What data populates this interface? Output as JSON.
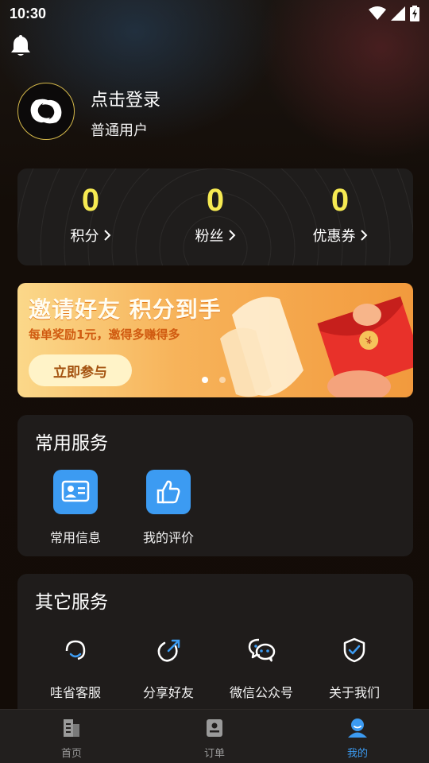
{
  "status_bar": {
    "time": "10:30"
  },
  "profile": {
    "login_label": "点击登录",
    "user_type": "普通用户"
  },
  "stats": [
    {
      "value": "0",
      "label": "积分"
    },
    {
      "value": "0",
      "label": "粉丝"
    },
    {
      "value": "0",
      "label": "优惠券"
    }
  ],
  "banner": {
    "title": "邀请好友 积分到手",
    "subtitle": "每单奖励1元，邀得多赚得多",
    "button_label": "立即参与",
    "page_count": 2,
    "active_page": 1
  },
  "common_services": {
    "title": "常用服务",
    "items": [
      {
        "label": "常用信息",
        "icon": "id-card-icon"
      },
      {
        "label": "我的评价",
        "icon": "thumbs-up-icon"
      }
    ]
  },
  "other_services": {
    "title": "其它服务",
    "items": [
      {
        "label": "哇省客服",
        "icon": "headset-icon"
      },
      {
        "label": "分享好友",
        "icon": "share-icon"
      },
      {
        "label": "微信公众号",
        "icon": "wechat-icon"
      },
      {
        "label": "关于我们",
        "icon": "shield-check-icon"
      }
    ]
  },
  "tabbar": {
    "items": [
      {
        "label": "首页",
        "icon": "home-doc-icon",
        "active": false
      },
      {
        "label": "订单",
        "icon": "order-icon",
        "active": false
      },
      {
        "label": "我的",
        "icon": "profile-icon",
        "active": true
      }
    ]
  },
  "colors": {
    "accent_blue": "#3c9bf2",
    "stat_yellow": "#f6ea52",
    "card_bg": "#1f1c1b"
  }
}
